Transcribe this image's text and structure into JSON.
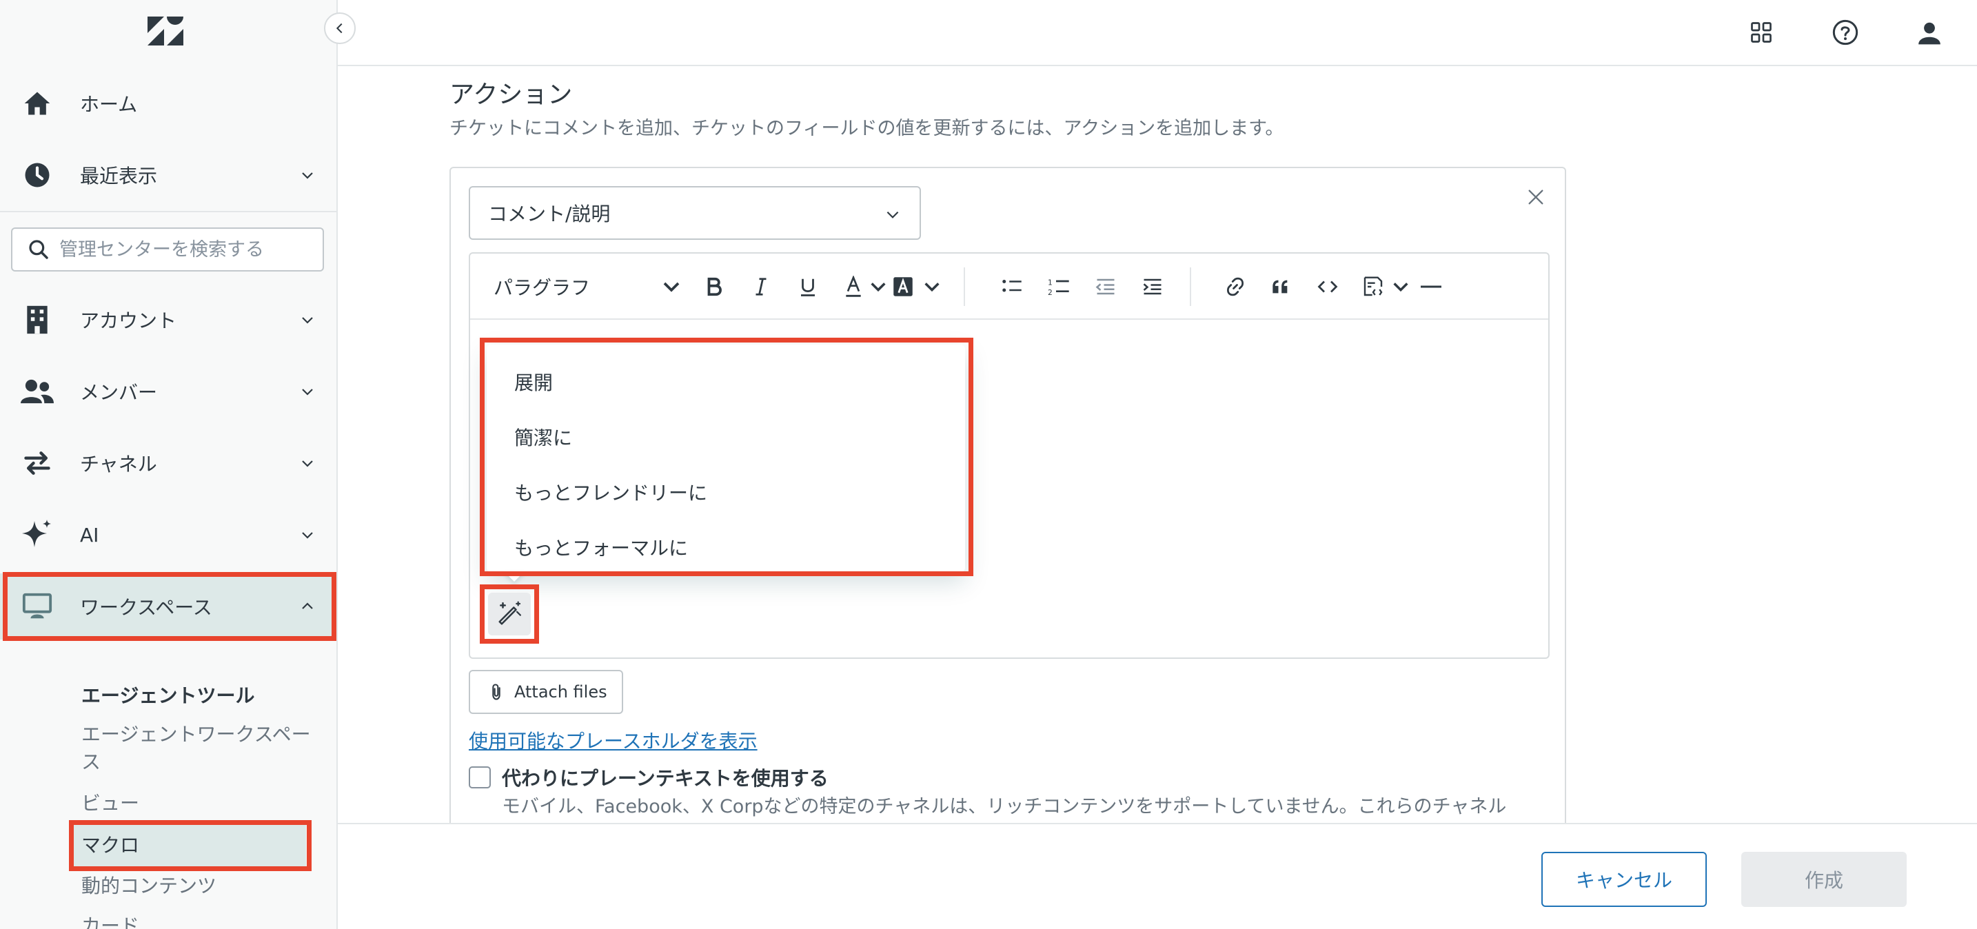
{
  "sidebar": {
    "logo": "zendesk-logo",
    "collapse_icon": "chevron-left-icon",
    "search_placeholder": "管理センターを検索する",
    "items": [
      {
        "label": "ホーム",
        "icon": "home-icon"
      },
      {
        "label": "最近表示",
        "icon": "clock-icon"
      },
      {
        "label": "アカウント",
        "icon": "building-icon"
      },
      {
        "label": "メンバー",
        "icon": "people-icon"
      },
      {
        "label": "チャネル",
        "icon": "arrows-exchange-icon"
      },
      {
        "label": "AI",
        "icon": "sparkle-icon"
      },
      {
        "label": "ワークスペース",
        "icon": "monitor-icon"
      }
    ],
    "workspace_sub": {
      "heading": "エージェントツール",
      "items": [
        {
          "label": "エージェントワークスペース"
        },
        {
          "label": "ビュー"
        },
        {
          "label": "マクロ"
        },
        {
          "label": "動的コンテンツ"
        },
        {
          "label": "カード"
        }
      ]
    }
  },
  "topbar": {
    "icons": [
      "grid-apps-icon",
      "help-icon",
      "user-avatar-icon"
    ]
  },
  "action_section": {
    "title": "アクション",
    "description": "チケットにコメントを追加、チケットのフィールドの値を更新するには、アクションを追加します。",
    "select_value": "コメント/説明",
    "editor": {
      "paragraph_label": "パラグラフ",
      "ai_menu": [
        "展開",
        "簡潔に",
        "もっとフレンドリーに",
        "もっとフォーマルに"
      ]
    },
    "attach_label": "Attach files",
    "placeholder_link": "使用可能なプレースホルダを表示",
    "plain_text_label": "代わりにプレーンテキストを使用する",
    "plain_text_desc": "モバイル、Facebook、X Corpなどの特定のチャネルは、リッチコンテンツをサポートしていません。これらのチャネル"
  },
  "footer": {
    "cancel": "キャンセル",
    "create": "作成"
  },
  "colors": {
    "accent": "#1f73b7",
    "highlight": "#e8442d",
    "active_bg": "#dde9e8"
  }
}
